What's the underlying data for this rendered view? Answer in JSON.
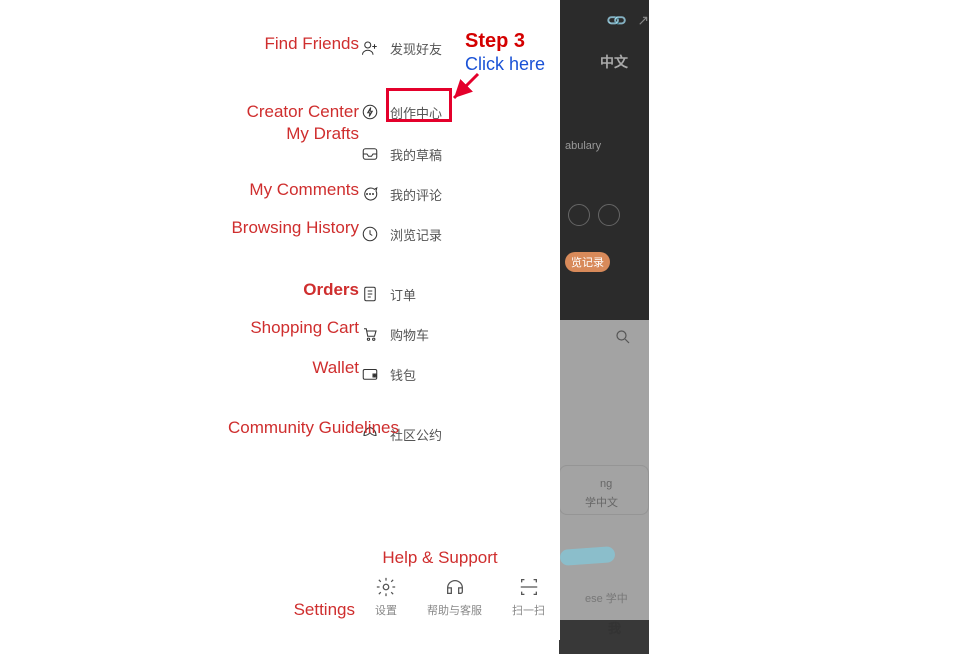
{
  "annotations": {
    "step_title": "Step 3",
    "step_action": "Click here"
  },
  "english_labels": {
    "find_friends": "Find Friends",
    "creator_center": "Creator Center",
    "my_drafts": "My Drafts",
    "my_comments": "My Comments",
    "browsing_history": "Browsing History",
    "orders": "Orders",
    "shopping_cart": "Shopping Cart",
    "wallet": "Wallet",
    "community_guidelines": "Community Guidelines",
    "help_support": "Help & Support",
    "settings": "Settings"
  },
  "menu": {
    "find_friends": "发现好友",
    "creator_center": "创作中心",
    "my_drafts": "我的草稿",
    "my_comments": "我的评论",
    "browsing_history": "浏览记录",
    "orders": "订单",
    "shopping_cart": "购物车",
    "wallet": "钱包",
    "community_guidelines": "社区公约"
  },
  "bottom_nav": {
    "settings": "设置",
    "help": "帮助与客服",
    "scan": "扫一扫"
  },
  "background": {
    "title_cn": "中文",
    "vocab": "abulary",
    "history": "览记录",
    "learn1": "ng",
    "learn2": "学中文",
    "ese": "ese 学中",
    "me_tab": "我"
  }
}
